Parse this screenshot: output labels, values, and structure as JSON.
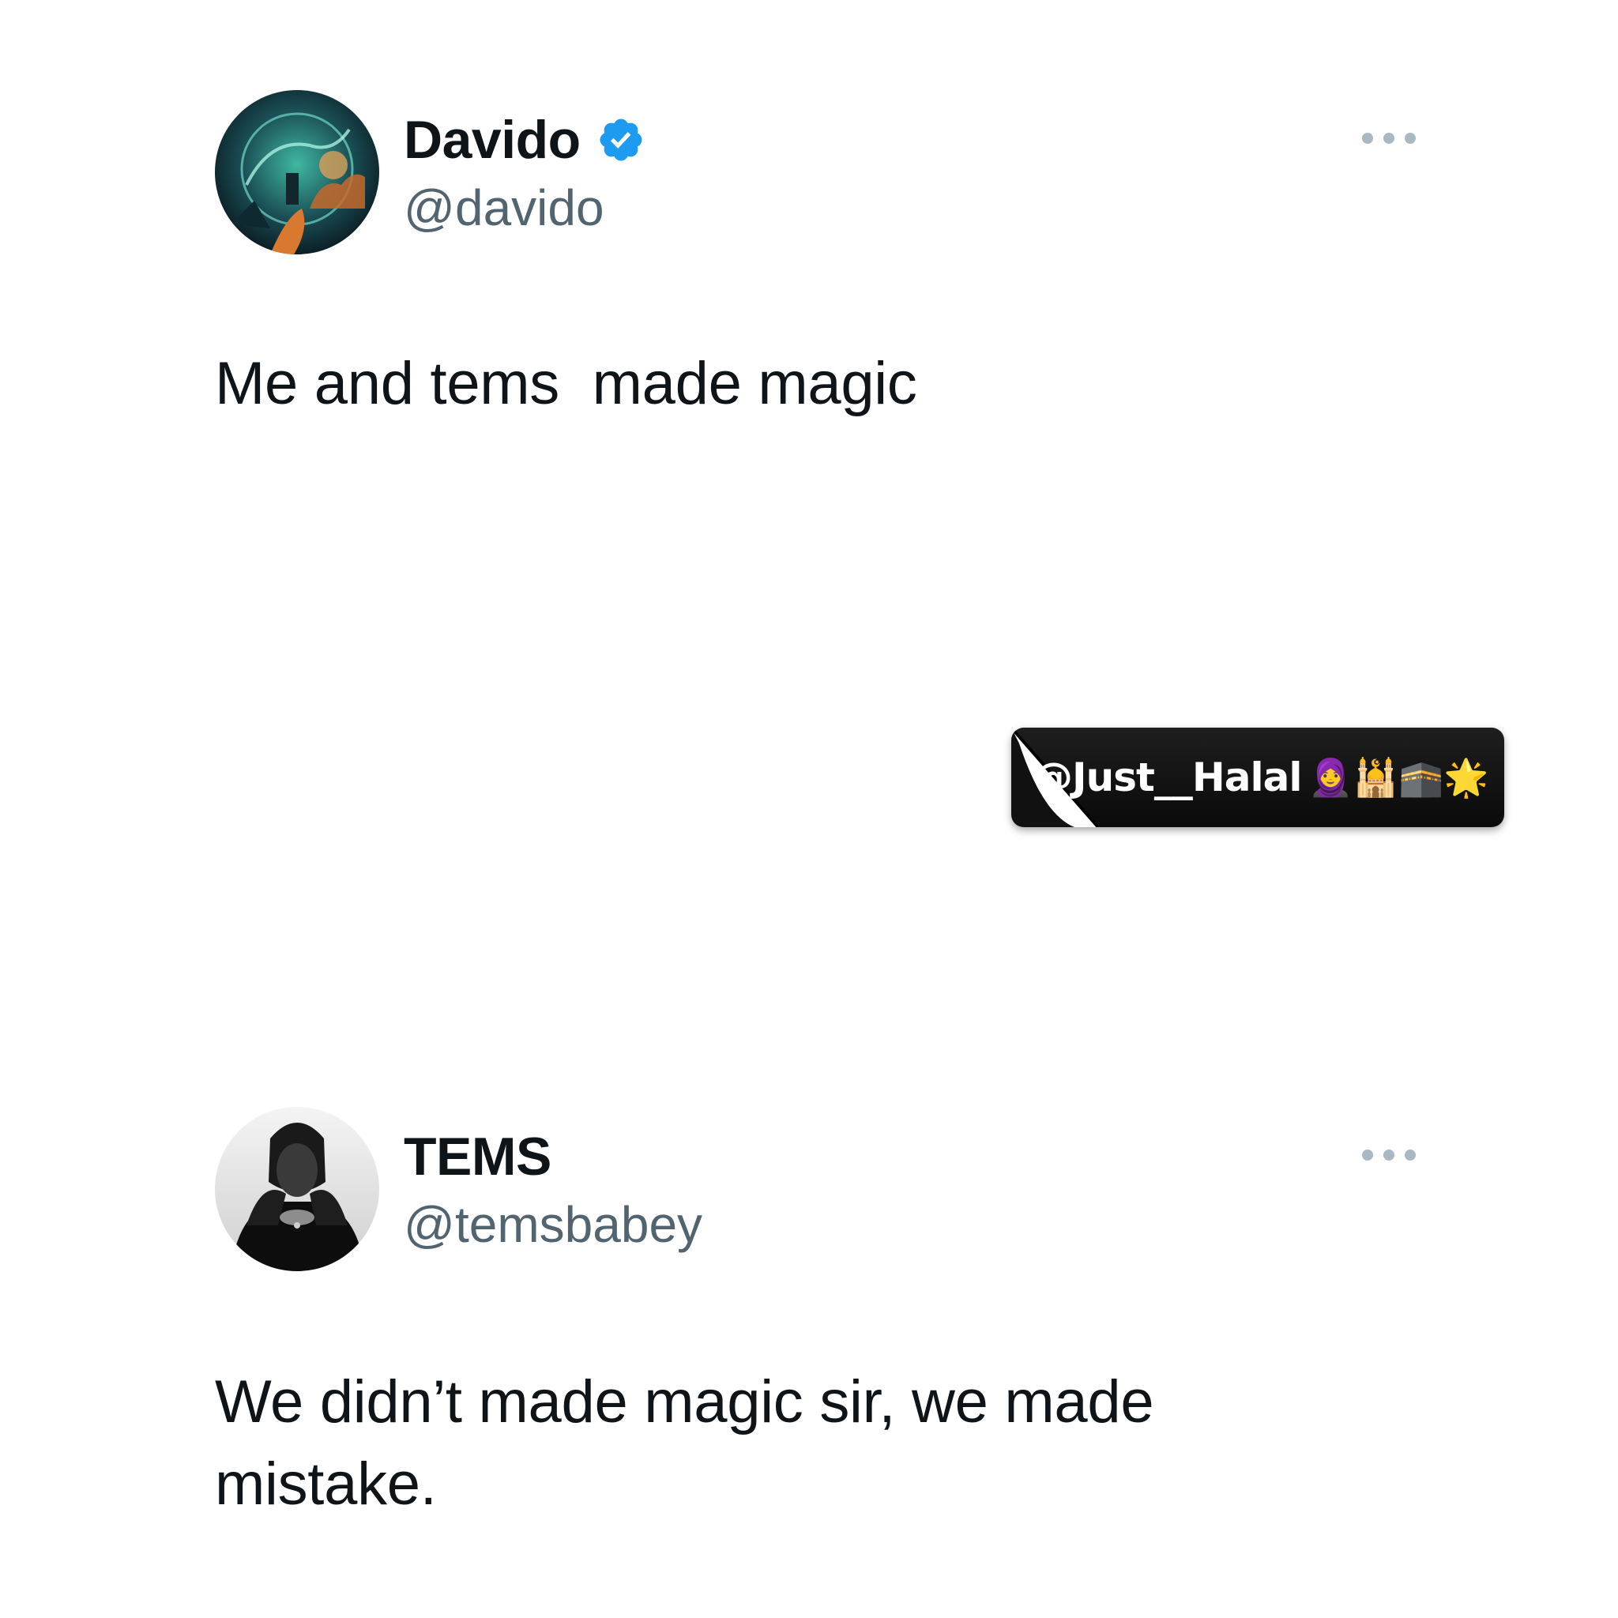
{
  "tweets": [
    {
      "display_name": "Davido",
      "verified": true,
      "handle": "@davido",
      "avatar_icon": "fantasy-landscape-avatar",
      "text": "Me and tems  made magic"
    },
    {
      "display_name": "TEMS",
      "verified": false,
      "handle": "@temsbabey",
      "avatar_icon": "portrait-avatar",
      "text": "We didn’t made magic sir, we made\nmistake."
    }
  ],
  "watermark": {
    "text": "@Just__Halal",
    "emojis": "🧕🕌🕋🌟"
  },
  "colors": {
    "background": "#ffffff",
    "text_primary": "#0f1419",
    "text_secondary": "#536471",
    "verified_blue": "#1d9bf0",
    "more_dots": "#aab8c2"
  }
}
